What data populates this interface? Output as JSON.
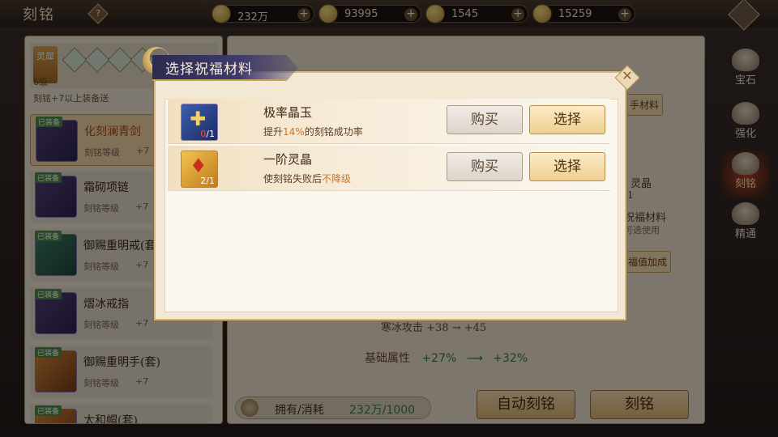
{
  "page": {
    "title": "刻铭",
    "help": "?"
  },
  "currencies": [
    {
      "icon": "coin-stack-icon",
      "value": "232万"
    },
    {
      "icon": "gold-coin-icon",
      "value": "93995"
    },
    {
      "icon": "gold-ingot-icon",
      "value": "1545"
    },
    {
      "icon": "gold-ingot-icon",
      "value": "15259"
    }
  ],
  "left_panel": {
    "level_badge": "灵犀",
    "level": "6级",
    "tip": "刻铭+7以上装备送",
    "equipment": [
      {
        "tag": "已装备",
        "name": "化刻澜青剑",
        "level_label": "刻铭等级",
        "level_value": "+7",
        "selected": true
      },
      {
        "tag": "已装备",
        "name": "霜砌项链",
        "level_label": "刻铭等级",
        "level_value": "+7"
      },
      {
        "tag": "已装备",
        "name": "御赐重明戒(套",
        "level_label": "刻铭等级",
        "level_value": "+7"
      },
      {
        "tag": "已装备",
        "name": "熠冰戒指",
        "level_label": "刻铭等级",
        "level_value": "+7"
      },
      {
        "tag": "已装备",
        "name": "御赐重明手(套)",
        "level_label": "刻铭等级",
        "level_value": "+7"
      },
      {
        "tag": "已装备",
        "name": "太和帽(套)",
        "level_label": "",
        "level_value": ""
      }
    ]
  },
  "right_panel": {
    "frag_material": "手材料",
    "frag_crystal": "灵晶",
    "frag_count": "/1",
    "frag_blessing": "祝福材料",
    "frag_optional": "可选使用",
    "frag_bonus": "福值加成",
    "frag_stat1": "寒冰攻击  +38  →  +45",
    "stat": {
      "label": "基础属性",
      "from": "+27%",
      "to": "+32%"
    },
    "own": {
      "label": "拥有/消耗",
      "value": "232万/1000"
    },
    "auto_button": "自动刻铭",
    "engrave_button": "刻铭"
  },
  "side_nav": [
    {
      "label": "宝石",
      "icon": "gem-icon"
    },
    {
      "label": "强化",
      "icon": "forge-icon"
    },
    {
      "label": "刻铭",
      "icon": "engrave-icon",
      "active": true
    },
    {
      "label": "精通",
      "icon": "mastery-icon"
    }
  ],
  "modal": {
    "title": "选择祝福材料",
    "close": "✕",
    "items": [
      {
        "name": "极率晶玉",
        "count_have": "0",
        "count_need": "/1",
        "desc_prefix": "提升",
        "desc_highlight": "14%",
        "desc_suffix": "的刻铭成功率",
        "buy_label": "购买",
        "select_label": "选择"
      },
      {
        "name": "一阶灵晶",
        "count_have": "2",
        "count_need": "/1",
        "desc_prefix": "使刻铭失败后",
        "desc_highlight": "不降级",
        "desc_suffix": "",
        "buy_label": "购买",
        "select_label": "选择"
      }
    ]
  }
}
